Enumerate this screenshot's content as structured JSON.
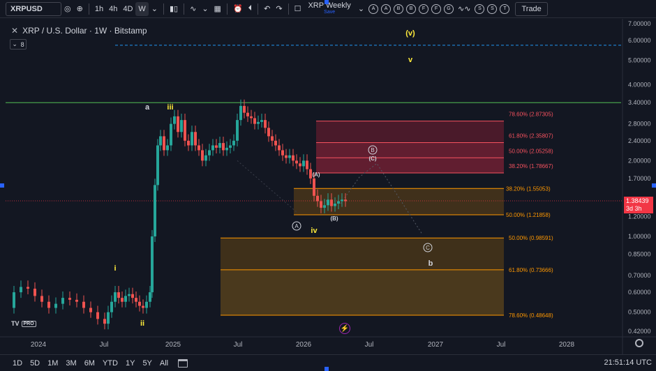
{
  "toolbar": {
    "symbol": "XRPUSD",
    "intervals": [
      "1h",
      "4h",
      "4D",
      "W"
    ],
    "active_interval": "W",
    "layout_name": "XRP Weekly",
    "save_label": "Save",
    "circle_letters": [
      "A",
      "A",
      "B",
      "B",
      "F",
      "F",
      "G",
      "S",
      "S",
      "T"
    ],
    "trade_label": "Trade"
  },
  "legend": {
    "title": "XRP / U.S. Dollar · 1W · Bitstamp",
    "indicators_count": "8"
  },
  "price_axis": {
    "labels": [
      "7.00000",
      "6.00000",
      "5.00000",
      "4.00000",
      "3.40000",
      "2.80000",
      "2.40000",
      "2.00000",
      "1.70000",
      "1.20000",
      "1.00000",
      "0.85000",
      "0.70000",
      "0.60000",
      "0.50000",
      "0.42000"
    ],
    "current_price": "1.38439",
    "countdown": "3d 3h"
  },
  "time_axis": {
    "labels": [
      "2024",
      "Jul",
      "2025",
      "Jul",
      "2026",
      "Jul",
      "2027",
      "Jul",
      "2028"
    ]
  },
  "fib_labels": {
    "upper": [
      "78.60% (2.87305)",
      "61.80% (2.35807)",
      "50.00% (2.05258)",
      "38.20% (1.78667)"
    ],
    "middle": [
      "38.20% (1.55053)",
      "50.00% (1.21858)"
    ],
    "lower": [
      "50.00% (0.98591)",
      "61.80% (0.73666)",
      "78.60% (0.48648)"
    ]
  },
  "wave_labels": {
    "v_paren": "(v)",
    "v": "v",
    "a": "a",
    "iii": "iii",
    "i": "i",
    "ii": "ii",
    "iv": "iv",
    "A_circ": "A",
    "B_circ": "B",
    "C_circ": "C",
    "A_paren": "(A)",
    "B_paren": "(B)",
    "C_paren": "(C)",
    "b": "b"
  },
  "branding": {
    "logo": "TV",
    "pro": "PRO"
  },
  "bottom": {
    "ranges": [
      "1D",
      "5D",
      "1M",
      "3M",
      "6M",
      "YTD",
      "1Y",
      "5Y",
      "All"
    ],
    "clock": "21:51:14 UTC"
  },
  "colors": {
    "bg": "#131722",
    "up": "#26a69a",
    "down": "#ef5350",
    "green_line": "#4caf50",
    "fib_red": "#f7525f",
    "fib_orange": "#ff9800",
    "wave_yellow": "#ffeb3b",
    "dashed_blue": "#2196f3"
  }
}
